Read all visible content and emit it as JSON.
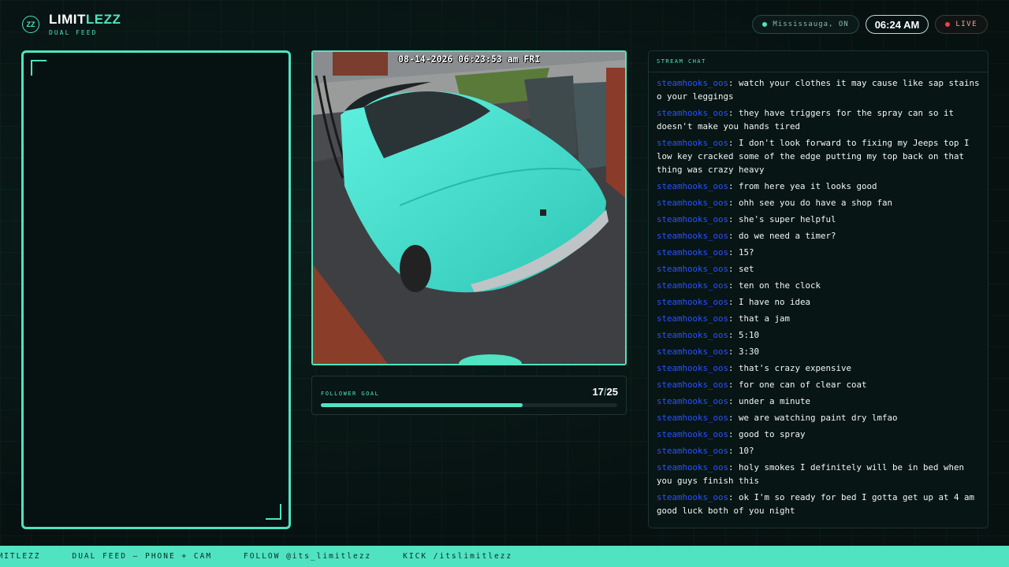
{
  "brand": {
    "logo_text": "ZZ",
    "title_main": "LIMIT",
    "title_accent": "LEZZ",
    "subtitle": "DUAL FEED"
  },
  "header": {
    "location": "Mississauga, ON",
    "time": "06:24 AM",
    "live_label": "LIVE"
  },
  "camera": {
    "timestamp": "08-14-2026 06:23:53 am FRI"
  },
  "follower_goal": {
    "label": "FOLLOWER GOAL",
    "current": "17",
    "separator": "/",
    "target": "25",
    "progress_fraction": 0.68
  },
  "chat": {
    "title": "STREAM CHAT",
    "messages": [
      {
        "user": "steamhooks_oos",
        "text": "watch your clothes it may cause like sap stains o your leggings"
      },
      {
        "user": "steamhooks_oos",
        "text": "they have triggers for the spray can so it doesn't make you hands tired"
      },
      {
        "user": "steamhooks_oos",
        "text": "I don't look forward to fixing my Jeeps top I low key cracked some of the edge putting my top back on that thing was crazy heavy"
      },
      {
        "user": "steamhooks_oos",
        "text": "from here yea it looks good"
      },
      {
        "user": "steamhooks_oos",
        "text": "ohh see you do have a shop fan"
      },
      {
        "user": "steamhooks_oos",
        "text": "she's super helpful"
      },
      {
        "user": "steamhooks_oos",
        "text": "do we need a timer?"
      },
      {
        "user": "steamhooks_oos",
        "text": "15?"
      },
      {
        "user": "steamhooks_oos",
        "text": "set"
      },
      {
        "user": "steamhooks_oos",
        "text": "ten on the clock"
      },
      {
        "user": "steamhooks_oos",
        "text": "I have no idea"
      },
      {
        "user": "steamhooks_oos",
        "text": "that a jam"
      },
      {
        "user": "steamhooks_oos",
        "text": "5:10"
      },
      {
        "user": "steamhooks_oos",
        "text": "3:30"
      },
      {
        "user": "steamhooks_oos",
        "text": "that's crazy expensive"
      },
      {
        "user": "steamhooks_oos",
        "text": "for one can of clear coat"
      },
      {
        "user": "steamhooks_oos",
        "text": "under a minute"
      },
      {
        "user": "steamhooks_oos",
        "text": "we are watching paint dry lmfao"
      },
      {
        "user": "steamhooks_oos",
        "text": "good to spray"
      },
      {
        "user": "steamhooks_oos",
        "text": "10?"
      },
      {
        "user": "steamhooks_oos",
        "text": "holy smokes I definitely will be in bed when you guys finish this"
      },
      {
        "user": "steamhooks_oos",
        "text": "ok I'm so ready for bed I gotta get up at 4 am good luck both of you night"
      }
    ]
  },
  "ticker": {
    "items": [
      "LIMITLEZZ",
      "DUAL FEED — PHONE + CAM",
      "FOLLOW @its_limitlezz",
      "KICK /itslimitlezz"
    ]
  },
  "colors": {
    "accent": "#4fe3c1",
    "background": "#071514",
    "live_dot": "#ff3b4f",
    "chat_username": "#2a52ff"
  },
  "icons": {
    "location": "location-dot-icon",
    "live": "live-dot-icon",
    "logo": "zz-logo-icon"
  }
}
